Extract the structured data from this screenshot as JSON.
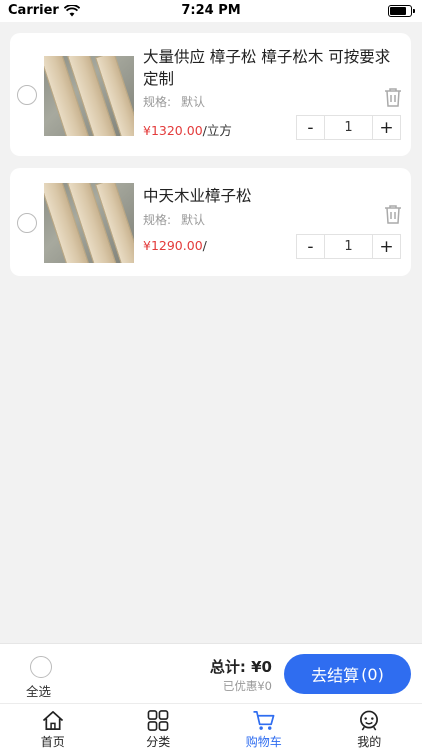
{
  "status_bar": {
    "carrier": "Carrier",
    "time": "7:24 PM"
  },
  "cart_items": [
    {
      "title": "大量供应 樟子松 樟子松木 可按要求定制",
      "spec_label": "规格:",
      "spec_value": "默认",
      "price": "¥1320.00",
      "unit": "/立方",
      "quantity": "1",
      "minus": "-",
      "plus": "+"
    },
    {
      "title": "中天木业樟子松",
      "spec_label": "规格:",
      "spec_value": "默认",
      "price": "¥1290.00",
      "unit": "/",
      "quantity": "1",
      "minus": "-",
      "plus": "+"
    }
  ],
  "checkout": {
    "select_all": "全选",
    "total": "总计: ¥0",
    "discount": "已优惠¥0",
    "button_label": "去结算",
    "button_count": "(0)"
  },
  "tabbar": {
    "items": [
      {
        "label": "首页",
        "icon": "home-icon"
      },
      {
        "label": "分类",
        "icon": "grid-icon"
      },
      {
        "label": "购物车",
        "icon": "cart-icon"
      },
      {
        "label": "我的",
        "icon": "profile-icon"
      }
    ],
    "active_index": 2
  },
  "colors": {
    "accent": "#2f6df0",
    "price": "#e33b3b",
    "background": "#f2f2f2"
  }
}
